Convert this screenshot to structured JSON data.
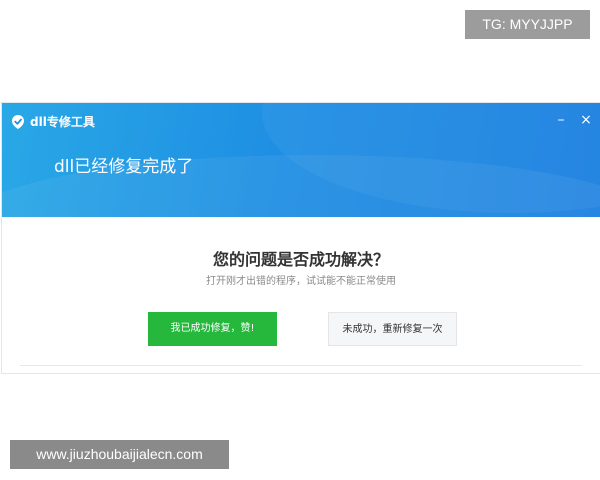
{
  "watermark": {
    "top_right": "TG: MYYJJPP",
    "bottom_left": "www.jiuzhoubaijialecn.com"
  },
  "window": {
    "app_name": "dll专修工具",
    "minimize_label": "–",
    "close_label": "×",
    "banner_title": "dll已经修复完成了"
  },
  "main": {
    "question": "您的问题是否成功解决？",
    "hint": "打开刚才出错的程序，试试能不能正常使用",
    "success_button": "我已成功修复，赞!",
    "retry_button": "未成功，重新修复一次"
  },
  "colors": {
    "banner_blue": "#1f8fe3",
    "success_green": "#25b83c"
  },
  "icons": {
    "app_logo": "tool-shield-icon"
  }
}
